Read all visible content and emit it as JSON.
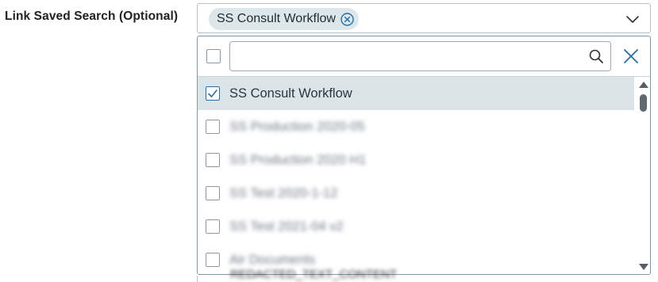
{
  "field": {
    "label": "Link Saved Search (Optional)"
  },
  "selected_chip": {
    "label": "SS Consult Workflow"
  },
  "search": {
    "value": "",
    "placeholder": ""
  },
  "options": [
    {
      "label": "SS Consult Workflow",
      "checked": true,
      "blurred": false
    },
    {
      "label": "SS Production 2020-05",
      "checked": false,
      "blurred": true
    },
    {
      "label": "SS Production 2020 H1",
      "checked": false,
      "blurred": true
    },
    {
      "label": "SS Test 2020-1-12",
      "checked": false,
      "blurred": true
    },
    {
      "label": "SS Test 2021-04 v2",
      "checked": false,
      "blurred": true
    },
    {
      "label": "Air Documents",
      "checked": false,
      "blurred": true
    }
  ],
  "underlying_text": "REDACTED_TEXT_CONTENT",
  "colors": {
    "accent": "#1f6fb0",
    "chip_bg": "#dde7ea",
    "selected_row_bg": "#dbe5e8",
    "border": "#b8c2cc"
  },
  "icons": {
    "chip_remove": "close-circle-icon",
    "dropdown_toggle": "chevron-down-icon",
    "search": "search-icon",
    "close": "close-icon",
    "check": "check-icon"
  }
}
